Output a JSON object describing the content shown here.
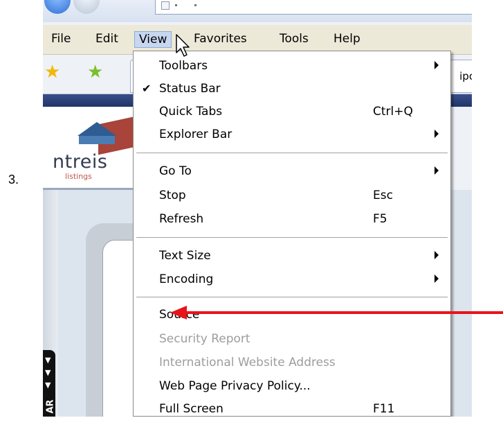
{
  "step_number": "3.",
  "menu_bar": {
    "items": [
      "File",
      "Edit",
      "View",
      "Favorites",
      "Tools",
      "Help"
    ],
    "active": "View"
  },
  "favorites_tab_fragment": "ipo",
  "logo": {
    "brand": "ntreis",
    "tagline": "listings"
  },
  "sidebar_label": "AR",
  "view_menu": {
    "groups": [
      [
        {
          "label": "Toolbars",
          "shortcut": "",
          "submenu": true,
          "checked": false,
          "disabled": false
        },
        {
          "label": "Status Bar",
          "shortcut": "",
          "submenu": false,
          "checked": true,
          "disabled": false
        },
        {
          "label": "Quick Tabs",
          "shortcut": "Ctrl+Q",
          "submenu": false,
          "checked": false,
          "disabled": false
        },
        {
          "label": "Explorer Bar",
          "shortcut": "",
          "submenu": true,
          "checked": false,
          "disabled": false
        }
      ],
      [
        {
          "label": "Go To",
          "shortcut": "",
          "submenu": true,
          "checked": false,
          "disabled": false
        },
        {
          "label": "Stop",
          "shortcut": "Esc",
          "submenu": false,
          "checked": false,
          "disabled": false
        },
        {
          "label": "Refresh",
          "shortcut": "F5",
          "submenu": false,
          "checked": false,
          "disabled": false
        }
      ],
      [
        {
          "label": "Text Size",
          "shortcut": "",
          "submenu": true,
          "checked": false,
          "disabled": false
        },
        {
          "label": "Encoding",
          "shortcut": "",
          "submenu": true,
          "checked": false,
          "disabled": false
        }
      ],
      [
        {
          "label": "Source",
          "shortcut": "",
          "submenu": false,
          "checked": false,
          "disabled": false
        },
        {
          "label": "Security Report",
          "shortcut": "",
          "submenu": false,
          "checked": false,
          "disabled": true
        },
        {
          "label": "International Website Address",
          "shortcut": "",
          "submenu": false,
          "checked": false,
          "disabled": true
        },
        {
          "label": "Web Page Privacy Policy...",
          "shortcut": "",
          "submenu": false,
          "checked": false,
          "disabled": false
        },
        {
          "label": "Full Screen",
          "shortcut": "F11",
          "submenu": false,
          "checked": false,
          "disabled": false
        }
      ]
    ]
  },
  "annotation": {
    "points_to": "Source",
    "color": "#e8141b"
  },
  "colors": {
    "menu_bar_bg": "#ece9d8",
    "active_menu_highlight": "#c8d7f0",
    "nav_bar": "#2c3f78",
    "disabled_text": "#9d9d9d"
  }
}
